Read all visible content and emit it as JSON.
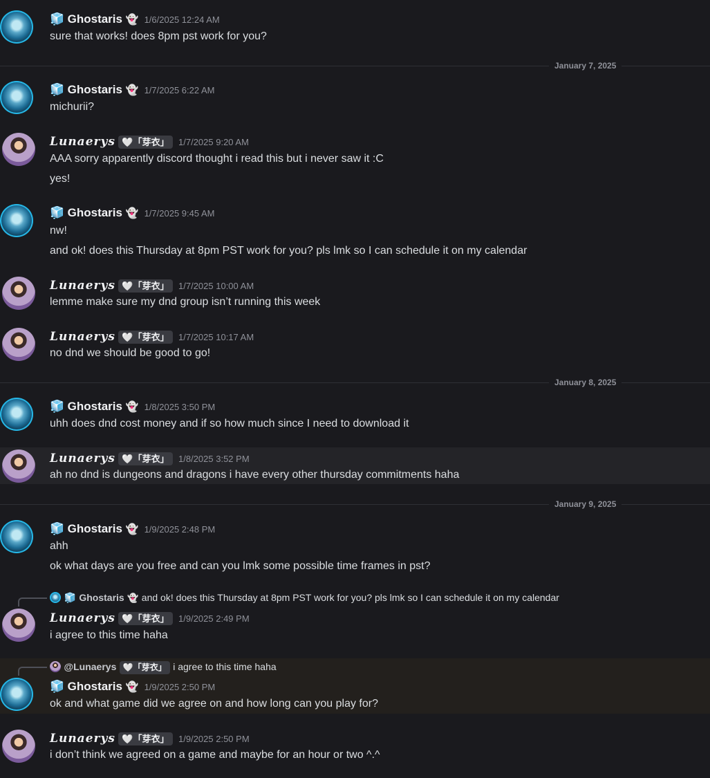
{
  "labels": {
    "cube": "🧊",
    "ghost": "👻",
    "ghostaris": "Ghostaris",
    "lunaerys": "Lunaerys",
    "lunaerys_mention": "@Lunaerys",
    "tag": "🤍「芽衣」"
  },
  "dividers": {
    "d1": "January 7, 2025",
    "d2": "January 8, 2025",
    "d3": "January 9, 2025"
  },
  "m1": {
    "time": "1/6/2025 12:24 AM",
    "t1": "sure that works! does 8pm pst work for you?"
  },
  "m2": {
    "time": "1/7/2025 6:22 AM",
    "t1": "michurii?"
  },
  "m3": {
    "time": "1/7/2025 9:20 AM",
    "t1": "AAA sorry apparently discord thought i read this but i never saw it :C",
    "t2": "yes!"
  },
  "m4": {
    "time": "1/7/2025 9:45 AM",
    "t1": "nw!",
    "t2": "and ok! does this Thursday at 8pm PST work for you? pls lmk so I can schedule it on my calendar"
  },
  "m5": {
    "time": "1/7/2025 10:00 AM",
    "t1": "lemme make sure my dnd group isn’t running this week"
  },
  "m6": {
    "time": "1/7/2025 10:17 AM",
    "t1": "no dnd we should be good to go!"
  },
  "m7": {
    "time": "1/8/2025 3:50 PM",
    "t1": "uhh does dnd cost money and if so how much since I need to download it"
  },
  "m8": {
    "time": "1/8/2025 3:52 PM",
    "t1": "ah no dnd is dungeons and dragons i have every other thursday commitments haha"
  },
  "m9": {
    "time": "1/9/2025 2:48 PM",
    "t1": "ahh",
    "t2": "ok what days are you free and can you lmk some possible time frames in pst?"
  },
  "m10": {
    "reply": "and ok! does this Thursday at 8pm PST work for you? pls lmk so I can schedule it on my calendar",
    "time": "1/9/2025 2:49 PM",
    "t1": "i agree to this time haha"
  },
  "m11": {
    "reply": "i agree to this time haha",
    "time": "1/9/2025 2:50 PM",
    "t1": "ok and what game did we agree on and how long can you play for?"
  },
  "m12": {
    "time": "1/9/2025 2:50 PM",
    "t1": "i don’t think we agreed on a game and maybe for an hour or two ^.^"
  }
}
